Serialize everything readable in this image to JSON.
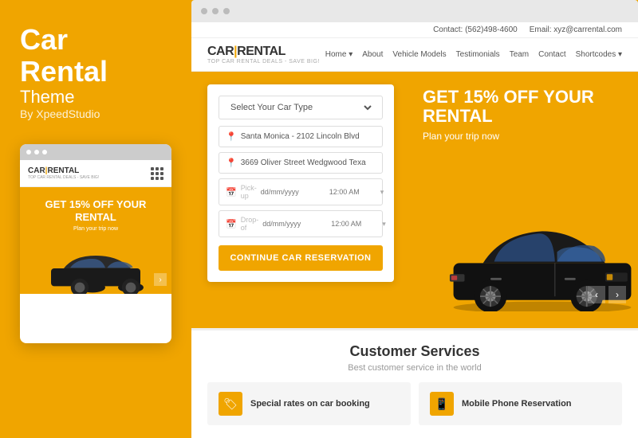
{
  "left": {
    "title_line1": "Car",
    "title_line2": "Rental",
    "subtitle": "Theme",
    "by": "By XpeedStudio"
  },
  "mobile": {
    "logo": "CAR|RENTAL",
    "logo_sep": "|",
    "logo_sub": "TOP CAR RENTAL DEALS - SAVE BIG!",
    "hero_title_line1": "GET 15% OFF YOUR",
    "hero_title_line2": "RENTAL",
    "hero_sub": "Plan your trip now"
  },
  "topbar": {
    "contact": "Contact: (562)498-4600",
    "email": "Email: xyz@carrental.com"
  },
  "nav": {
    "logo": "CAR|RENTAL",
    "logo_sub": "TOP CAR RENTAL DEALS - SAVE BIG!",
    "links": [
      "Home",
      "About",
      "Vehicle Models",
      "Testimonials",
      "Team",
      "Contact",
      "Shortcodes"
    ]
  },
  "hero": {
    "badge_line1": "GET 15% OFF YOUR RENTAL",
    "plan": "Plan your trip now",
    "form": {
      "select_placeholder": "Select Your Car Type",
      "pickup_location": "Santa Monica - 2102 Lincoln Blvd",
      "dropoff_location": "3669 Oliver Street Wedgwood Texa",
      "pickup_date": "dd/mm/yyyy",
      "pickup_time": "12:00 AM",
      "dropoff_date": "dd/mm/yyyy",
      "dropoff_time": "12:00 AM",
      "btn_label": "CONTINUE CAR RESERVATION"
    }
  },
  "customer": {
    "title": "Customer Services",
    "subtitle": "Best customer service in the world",
    "services": [
      {
        "label": "Special rates on car booking",
        "icon": "🏷"
      },
      {
        "label": "Mobile Phone Reservation",
        "icon": "📱"
      }
    ]
  }
}
